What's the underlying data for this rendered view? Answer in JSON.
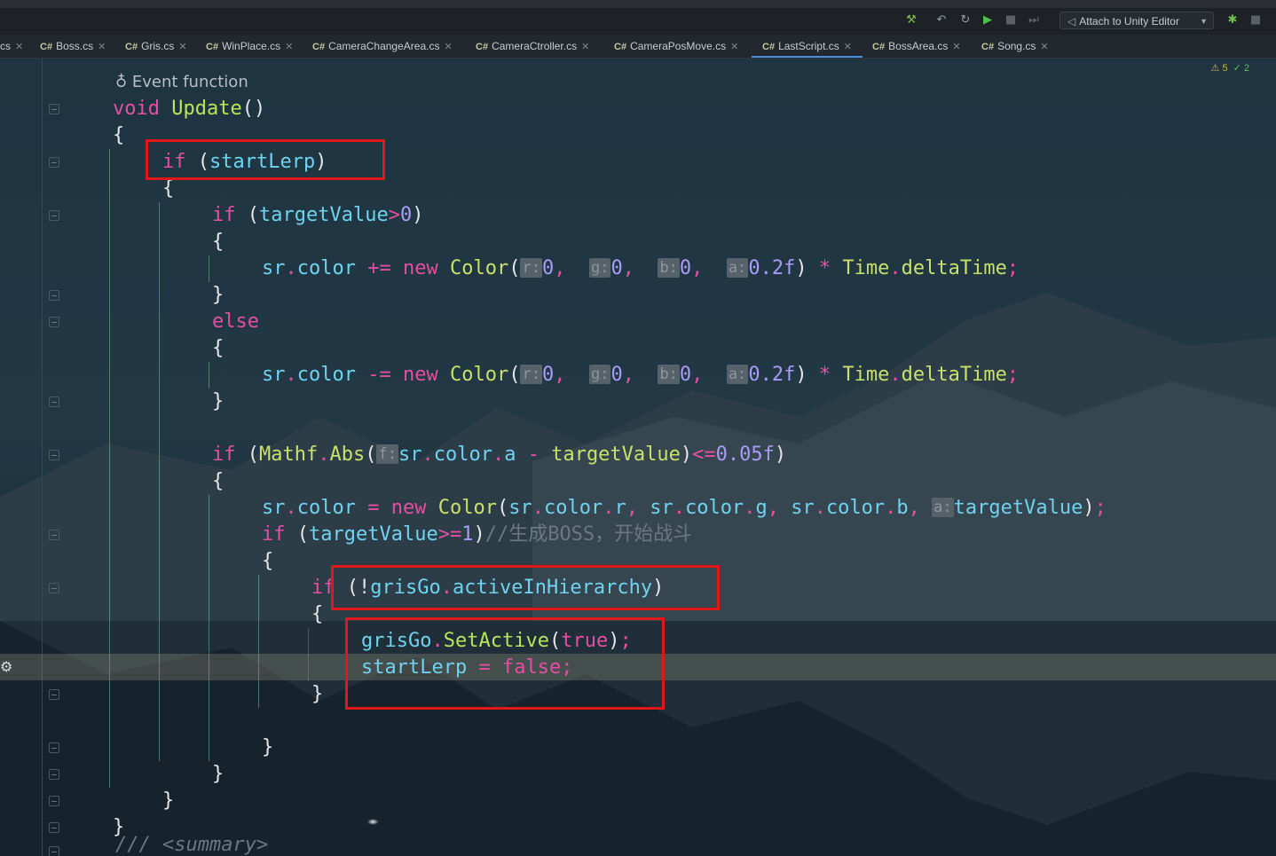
{
  "toolbar": {
    "attach_label": "Attach to Unity Editor",
    "icons": [
      "build-hammer-icon",
      "refresh-back-icon",
      "refresh-icon",
      "run-icon",
      "stop-icon",
      "step-icon",
      "debug-bug-icon",
      "square-icon"
    ]
  },
  "tabs": [
    {
      "label": "cs",
      "prefix": "",
      "active": false
    },
    {
      "label": "Boss.cs",
      "prefix": "C#",
      "active": false
    },
    {
      "label": "Gris.cs",
      "prefix": "C#",
      "active": false
    },
    {
      "label": "WinPlace.cs",
      "prefix": "C#",
      "active": false
    },
    {
      "label": "CameraChangeArea.cs",
      "prefix": "C#",
      "active": false
    },
    {
      "label": "CameraCtroller.cs",
      "prefix": "C#",
      "active": false
    },
    {
      "label": "CameraPosMove.cs",
      "prefix": "C#",
      "active": false
    },
    {
      "label": "LastScript.cs",
      "prefix": "C#",
      "active": true
    },
    {
      "label": "BossArea.cs",
      "prefix": "C#",
      "active": false
    },
    {
      "label": "Song.cs",
      "prefix": "C#",
      "active": false
    }
  ],
  "editor": {
    "inspection": {
      "warnings": "5",
      "ok": "2"
    },
    "meta_hint": "Event function",
    "code": {
      "void": "void",
      "update": "Update",
      "parens": "()",
      "open_brace": "{",
      "close_brace": "}",
      "if": "if",
      "else": "else",
      "startLerp": "startLerp",
      "targetValue": "targetValue",
      "sr": "sr",
      "color": "color",
      "new": "new",
      "Color": "Color",
      "Time": "Time",
      "deltaTime": "deltaTime",
      "Mathf": "Mathf",
      "Abs": "Abs",
      "grisGo": "grisGo",
      "activeInHierarchy": "activeInHierarchy",
      "SetActive": "SetActive",
      "true": "true",
      "false": "false",
      "zero": "0",
      "one": "1",
      "alpha_step": "0.2f",
      "tolerance": "0.05f",
      "hint_r": "r:",
      "hint_g": "g:",
      "hint_b": "b:",
      "hint_a": "a:",
      "hint_f": "f:",
      "hint_a_blank": "a:",
      "comment": "//生成BOSS，开始战斗",
      "summary": "/// <summary>"
    }
  }
}
